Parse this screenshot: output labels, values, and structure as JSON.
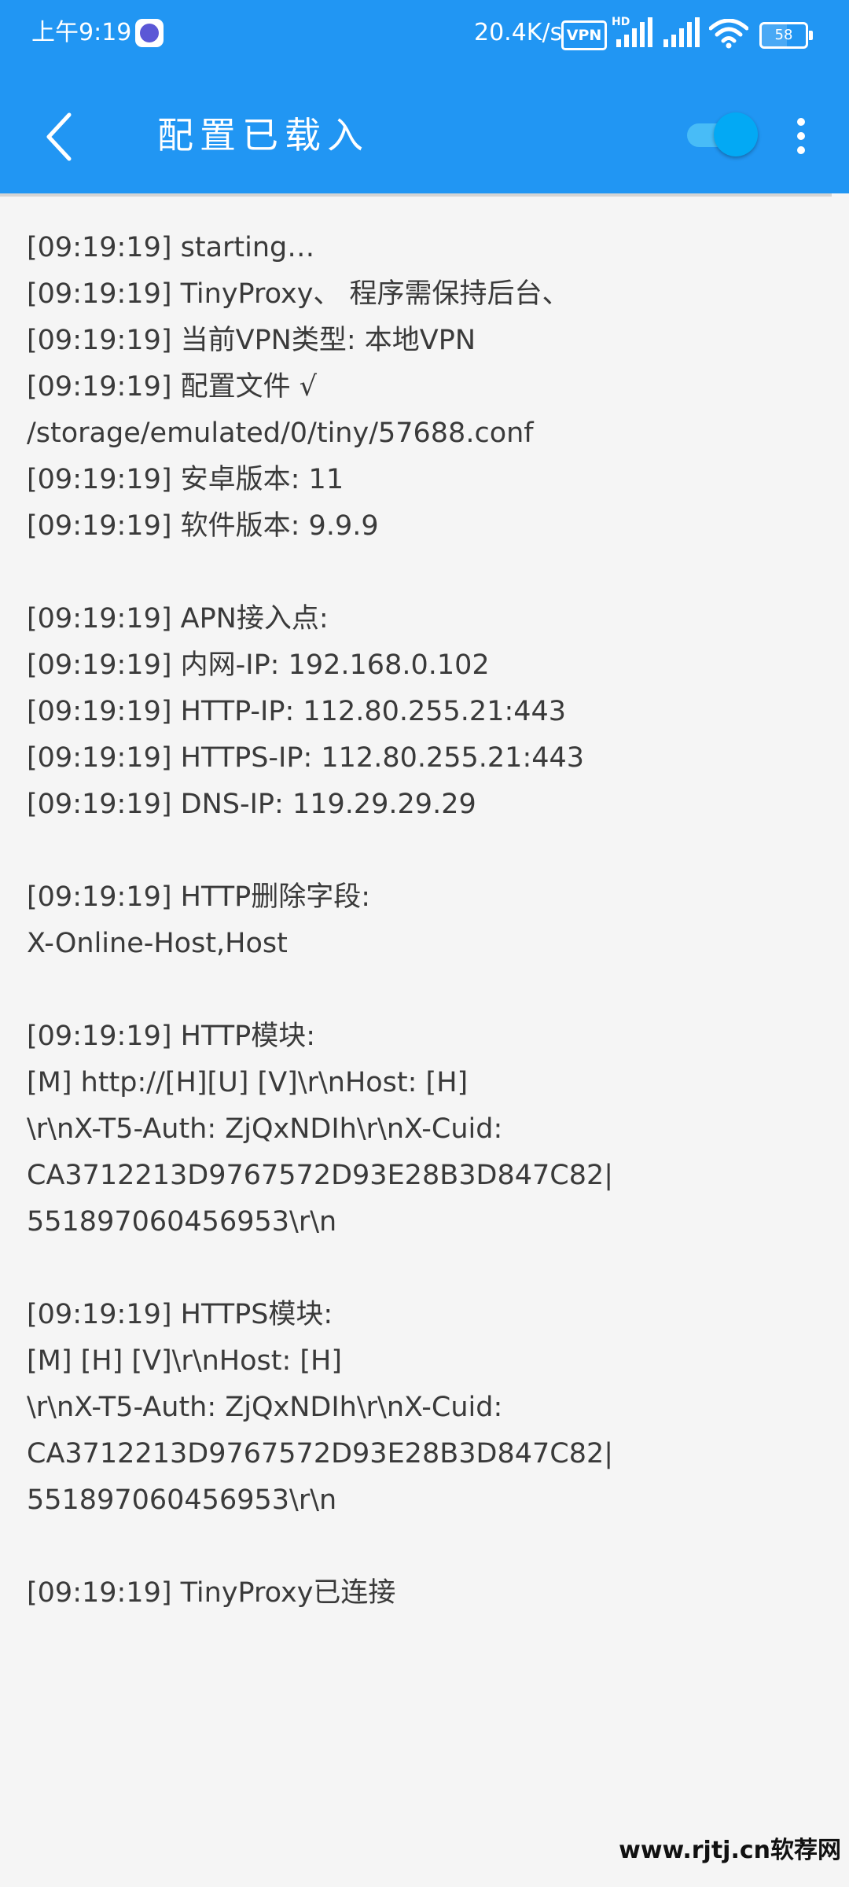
{
  "status_bar": {
    "time": "上午9:19",
    "network_speed": "20.4K/s",
    "vpn_badge": "VPN",
    "hd_label": "HD",
    "battery_level": "58",
    "icons": [
      "app-notification-icon",
      "vpn-icon",
      "signal-icon",
      "wifi-icon",
      "battery-icon"
    ]
  },
  "app_bar": {
    "title": "配置已载入",
    "back_icon": "chevron-left-icon",
    "toggle_on": true,
    "menu_icon": "more-vert-icon",
    "background_color": "#2196f3",
    "toggle_color": "#03a9f4"
  },
  "log_lines": [
    "[09:19:19] starting…",
    "[09:19:19] TinyProxy、 程序需保持后台、",
    "[09:19:19] 当前VPN类型: 本地VPN",
    "[09:19:19] 配置文件 √",
    "/storage/emulated/0/tiny/57688.conf",
    "[09:19:19] 安卓版本: 11",
    "[09:19:19] 软件版本: 9.9.9",
    "",
    "[09:19:19] APN接入点:",
    "[09:19:19] 内网-IP: 192.168.0.102",
    "[09:19:19] HTTP-IP: 112.80.255.21:443",
    "[09:19:19] HTTPS-IP: 112.80.255.21:443",
    "[09:19:19] DNS-IP: 119.29.29.29",
    "",
    "[09:19:19] HTTP删除字段:",
    "X-Online-Host,Host",
    "",
    "[09:19:19] HTTP模块:",
    "[M] http://[H][U] [V]\\r\\nHost: [H]",
    "\\r\\nX-T5-Auth: ZjQxNDIh\\r\\nX-Cuid:",
    "CA3712213D9767572D93E28B3D847C82|",
    "551897060456953\\r\\n",
    "",
    "[09:19:19] HTTPS模块:",
    "[M] [H] [V]\\r\\nHost: [H]",
    "\\r\\nX-T5-Auth: ZjQxNDIh\\r\\nX-Cuid:",
    "CA3712213D9767572D93E28B3D847C82|",
    "551897060456953\\r\\n",
    "",
    "[09:19:19] TinyProxy已连接"
  ],
  "watermark": "www.rjtj.cn软荐网"
}
